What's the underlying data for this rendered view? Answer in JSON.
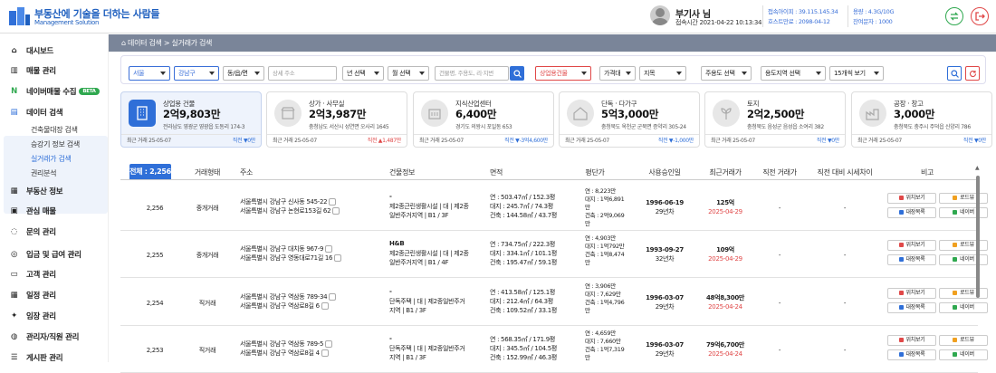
{
  "header": {
    "logo_title": "부동산에 기술을 더하는 사람들",
    "logo_subtitle": "Management Solution",
    "user_name": "부기사 님",
    "login_time": "접속시간 2021-04-22 10:13:34",
    "ip": "접속아이피 : 39.115.145.34",
    "host_expire": "호스트만료 : 2098-04-12",
    "capacity": "용량 : 4.3G/10G",
    "sms": "잔여문자 : 1000"
  },
  "sidebar": {
    "items": [
      {
        "label": "대시보드",
        "icon": "home-icon"
      },
      {
        "label": "매물 관리",
        "icon": "building-icon"
      },
      {
        "label": "네이버매물 수집",
        "icon": "naver-icon",
        "badge": "BETA"
      },
      {
        "label": "데이터 검색",
        "icon": "document-icon"
      },
      {
        "label": "부동산 정보",
        "icon": "file-icon"
      },
      {
        "label": "관심 매물",
        "icon": "bookmark-icon"
      },
      {
        "label": "문의 관리",
        "icon": "chat-icon"
      },
      {
        "label": "입금 및 급여 관리",
        "icon": "money-icon"
      },
      {
        "label": "고객 관리",
        "icon": "people-icon"
      },
      {
        "label": "일정 관리",
        "icon": "calendar-icon"
      },
      {
        "label": "임장 관리",
        "icon": "gear-icon"
      },
      {
        "label": "관리자/직원 관리",
        "icon": "admin-icon"
      },
      {
        "label": "게시판 관리",
        "icon": "board-icon"
      }
    ],
    "submenu": [
      "건축물대장 검색",
      "승강기 정보 검색",
      "실거래가 검색",
      "권리분석"
    ]
  },
  "breadcrumb": {
    "home": "데이터 검색",
    "current": "실거래가 검색"
  },
  "filters": {
    "city": "서울",
    "district": "강남구",
    "dong": "동/읍/면",
    "detail_placeholder": "상세 주소",
    "year": "년 선택",
    "month": "월 선택",
    "building_placeholder": "건물명, 주용도, 리·지번",
    "building_type": "상업용건물",
    "price": "가격대",
    "lot": "지목",
    "main_use": "주용도 선택",
    "zoning": "용도지역 선택",
    "view": "15개씩 보기"
  },
  "cards": [
    {
      "category": "상업용 건물",
      "value": "2억9,803만",
      "address": "전라남도 영광군 영광읍 도동리 174-3",
      "date": "최근 거래 25-05-07",
      "change": "직전 ▼0만",
      "change_color": "#2f6fd8",
      "icon": "office-building-icon"
    },
    {
      "category": "상가 · 사무실",
      "value": "2억3,987만",
      "address": "충청남도 서산시 성연면 오사리 1645",
      "date": "최근 거래 25-05-07",
      "change": "직전 ▲1,487만",
      "change_color": "#e04848",
      "icon": "store-icon"
    },
    {
      "category": "지식산업센터",
      "value": "6,400만",
      "address": "경기도 의왕시 포일동 653",
      "date": "최근 거래 25-05-07",
      "change": "직전 ▼-3억4,600만",
      "change_color": "#2f6fd8",
      "icon": "factory-building-icon"
    },
    {
      "category": "단독 · 다가구",
      "value": "5억3,000만",
      "address": "충청북도 옥천군 군북면 증약리 305-24",
      "date": "최근 거래 25-05-07",
      "change": "직전 ▼-1,000만",
      "change_color": "#2f6fd8",
      "icon": "house-icon"
    },
    {
      "category": "토지",
      "value": "2억2,500만",
      "address": "충청북도 음성군 음성읍 소여리 382",
      "date": "최근 거래 25-05-07",
      "change": "직전 ▼0만",
      "change_color": "#2f6fd8",
      "icon": "sprout-icon"
    },
    {
      "category": "공장 · 창고",
      "value": "3,000만",
      "address": "충청북도 충주시 주덕읍 신양리 786",
      "date": "최근 거래 25-05-07",
      "change": "직전 ▼0만",
      "change_color": "#2f6fd8",
      "icon": "factory-icon"
    }
  ],
  "table": {
    "total": "전체 : 2,256",
    "headers": [
      "거래형태",
      "주소",
      "건물정보",
      "면적",
      "평단가",
      "사용승인일",
      "최근거래가",
      "직전 거래가",
      "직전 대비 시세차이",
      "비고"
    ],
    "buttons": {
      "location": "위치보기",
      "road": "로드뷰",
      "ledger": "대장목록",
      "naver": "네이버"
    },
    "rows": [
      {
        "num": "2,256",
        "type": "중개거래",
        "addr1": "서울특별시 강남구 신사동 545-22",
        "addr2": "서울특별시 강남구 논현로153길 62",
        "b1": "-",
        "b2": "제2종근린생활시설 | 대 | 제2종",
        "b3": "일반주거지역 | B1 / 3F",
        "a1": "연 : 503.47㎡ / 152.3평",
        "a2": "대지 : 245.7㎡ / 74.3평",
        "a3": "건축 : 144.58㎡ / 43.7평",
        "p1": "연 : 8,223만",
        "p2": "대지 : 1억6,891",
        "p3": "만",
        "p4": "건축 : 2억9,069",
        "p5": "만",
        "date": "1996-06-19",
        "years": "29년차",
        "price": "125억",
        "pdate": "2025-04-29",
        "prev": "-",
        "diff": "-"
      },
      {
        "num": "2,255",
        "type": "중개거래",
        "addr1": "서울특별시 강남구 대치동 967-9",
        "addr2": "서울특별시 강남구 영동대로71길 16",
        "b1": "H&B",
        "b2": "제2종근린생활시설 | 대 | 제2종",
        "b3": "일반주거지역 | B1 / 4F",
        "a1": "연 : 734.75㎡ / 222.3평",
        "a2": "대지 : 334.1㎡ / 101.1평",
        "a3": "건축 : 195.47㎡ / 59.1평",
        "p1": "연 : 4,903만",
        "p2": "대지 : 1억792만",
        "p3": "",
        "p4": "건축 : 1억8,474",
        "p5": "만",
        "date": "1993-09-27",
        "years": "32년차",
        "price": "109억",
        "pdate": "2025-04-29",
        "prev": "-",
        "diff": "-"
      },
      {
        "num": "2,254",
        "type": "직거래",
        "addr1": "서울특별시 강남구 역삼동 789-34",
        "addr2": "서울특별시 강남구 역삼로8길 6",
        "b1": "-",
        "b2": "단독주택 | 대 | 제2종일반주거",
        "b3": "지역 | B1 / 3F",
        "a1": "연 : 413.58㎡ / 125.1평",
        "a2": "대지 : 212.4㎡ / 64.3평",
        "a3": "건축 : 109.52㎡ / 33.1평",
        "p1": "연 : 3,906만",
        "p2": "대지 : 7,629만",
        "p3": "",
        "p4": "건축 : 1억4,796",
        "p5": "만",
        "date": "1996-03-07",
        "years": "29년차",
        "price": "48억8,300만",
        "pdate": "2025-04-24",
        "prev": "-",
        "diff": "-"
      },
      {
        "num": "2,253",
        "type": "직거래",
        "addr1": "서울특별시 강남구 역삼동 789-5",
        "addr2": "서울특별시 강남구 역삼로8길 4",
        "b1": "-",
        "b2": "단독주택 | 대 | 제2종일반주거",
        "b3": "지역 | B1 / 3F",
        "a1": "연 : 568.35㎡ / 171.9평",
        "a2": "대지 : 345.5㎡ / 104.5평",
        "a3": "건축 : 152.99㎡ / 46.3평",
        "p1": "연 : 4,659만",
        "p2": "대지 : 7,660만",
        "p3": "",
        "p4": "건축 : 1억7,319",
        "p5": "만",
        "date": "1996-03-07",
        "years": "29년차",
        "price": "79억6,700만",
        "pdate": "2025-04-24",
        "prev": "-",
        "diff": "-"
      }
    ]
  }
}
